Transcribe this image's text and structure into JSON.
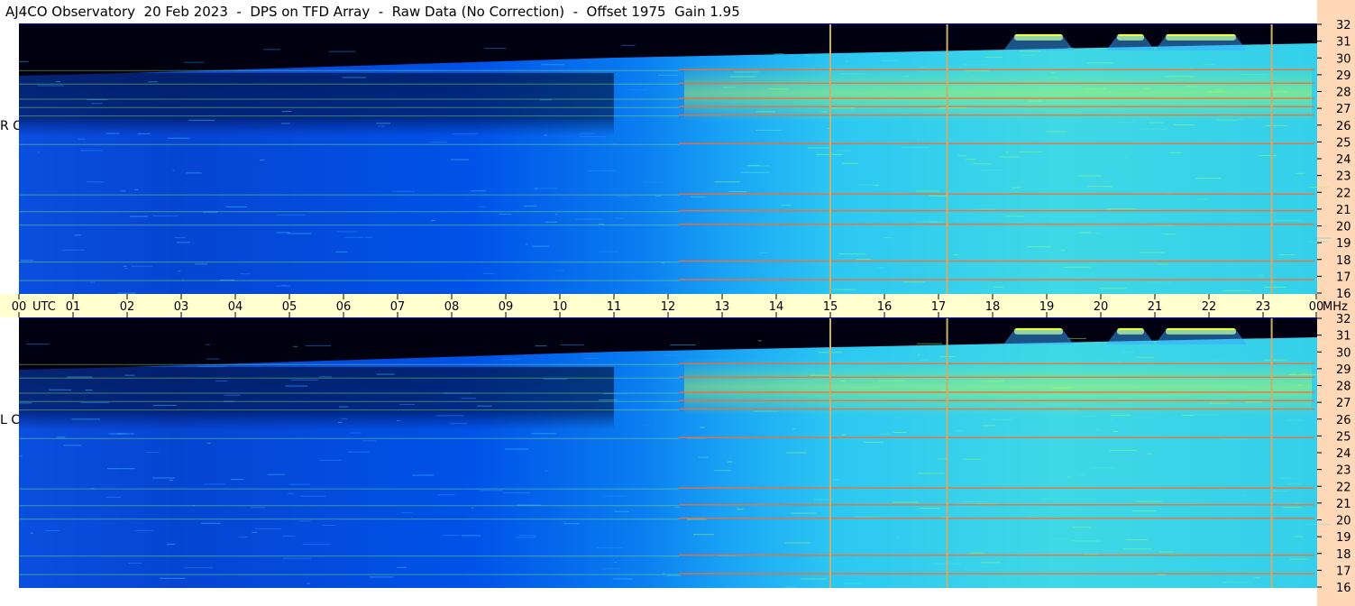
{
  "title": "AJ4CO Observatory  20 Feb 2023  -  DPS on TFD Array  -  Raw Data (No Correction)  -  Offset 1975  Gain 1.95",
  "panels": [
    {
      "label": "R C P"
    },
    {
      "label": "L C P"
    }
  ],
  "colors": {
    "background": "#ffffff",
    "time_axis": "#ffffd0",
    "freq_axis": "#ffd8b8",
    "colormap": [
      "#000000",
      "#00003c",
      "#0000a0",
      "#0050ff",
      "#00c8ff",
      "#80ff80",
      "#ffff00",
      "#ff4000",
      "#ff00c0",
      "#ffffff"
    ]
  },
  "chart_data": {
    "type": "heatmap",
    "x_unit": "UTC",
    "y_unit": "MHz",
    "x_ticks": [
      "00",
      "01",
      "02",
      "03",
      "04",
      "05",
      "06",
      "07",
      "08",
      "09",
      "10",
      "11",
      "12",
      "13",
      "14",
      "15",
      "16",
      "17",
      "18",
      "19",
      "20",
      "21",
      "22",
      "23",
      "00"
    ],
    "y_ticks": [
      "16",
      "17",
      "18",
      "19",
      "20",
      "21",
      "22",
      "23",
      "24",
      "25",
      "26",
      "27",
      "28",
      "29",
      "30",
      "31",
      "32"
    ],
    "xlim": [
      0,
      24
    ],
    "ylim": [
      16,
      32
    ],
    "panels": [
      "RCP",
      "LCP"
    ],
    "persistent_interference_mhz": [
      16.8,
      17.9,
      20.1,
      20.9,
      21.9,
      24.9,
      26.6,
      27.1,
      27.6,
      28.5,
      29.3
    ],
    "vertical_lines_utc": [
      15.0,
      17.16,
      23.16
    ],
    "solar_burst_segments": [
      {
        "start_utc": 18.4,
        "end_utc": 19.3,
        "freq_mhz": 31.2
      },
      {
        "start_utc": 20.3,
        "end_utc": 20.8,
        "freq_mhz": 31.2
      },
      {
        "start_utc": 21.2,
        "end_utc": 22.5,
        "freq_mhz": 31.2
      }
    ]
  }
}
